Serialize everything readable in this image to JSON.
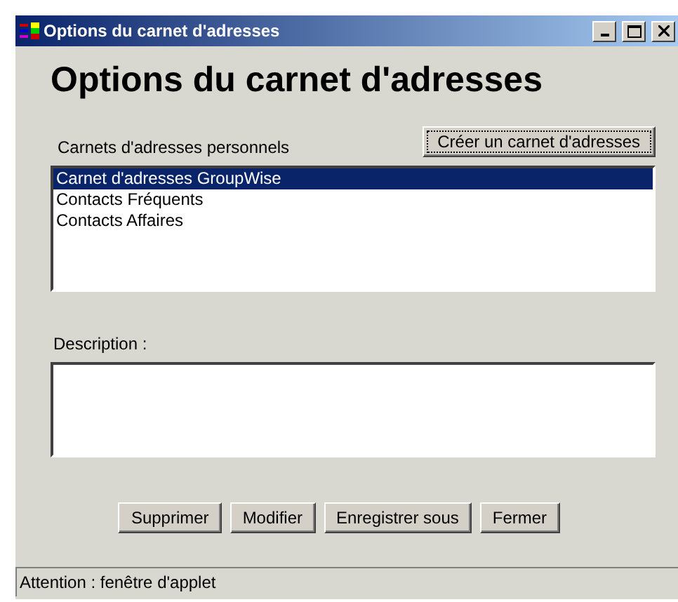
{
  "window": {
    "title": "Options du carnet d'adresses"
  },
  "heading": "Options du carnet d'adresses",
  "personal_books": {
    "label": "Carnets d'adresses personnels",
    "create_button": "Créer un carnet d'adresses",
    "items": [
      {
        "label": "Carnet d'adresses GroupWise",
        "selected": true
      },
      {
        "label": "Contacts Fréquents",
        "selected": false
      },
      {
        "label": "Contacts Affaires",
        "selected": false
      }
    ]
  },
  "description": {
    "label": "Description :"
  },
  "buttons": [
    "Supprimer",
    "Modifier",
    "Enregistrer sous",
    "Fermer"
  ],
  "status_bar": "Attention : fenêtre d'applet"
}
